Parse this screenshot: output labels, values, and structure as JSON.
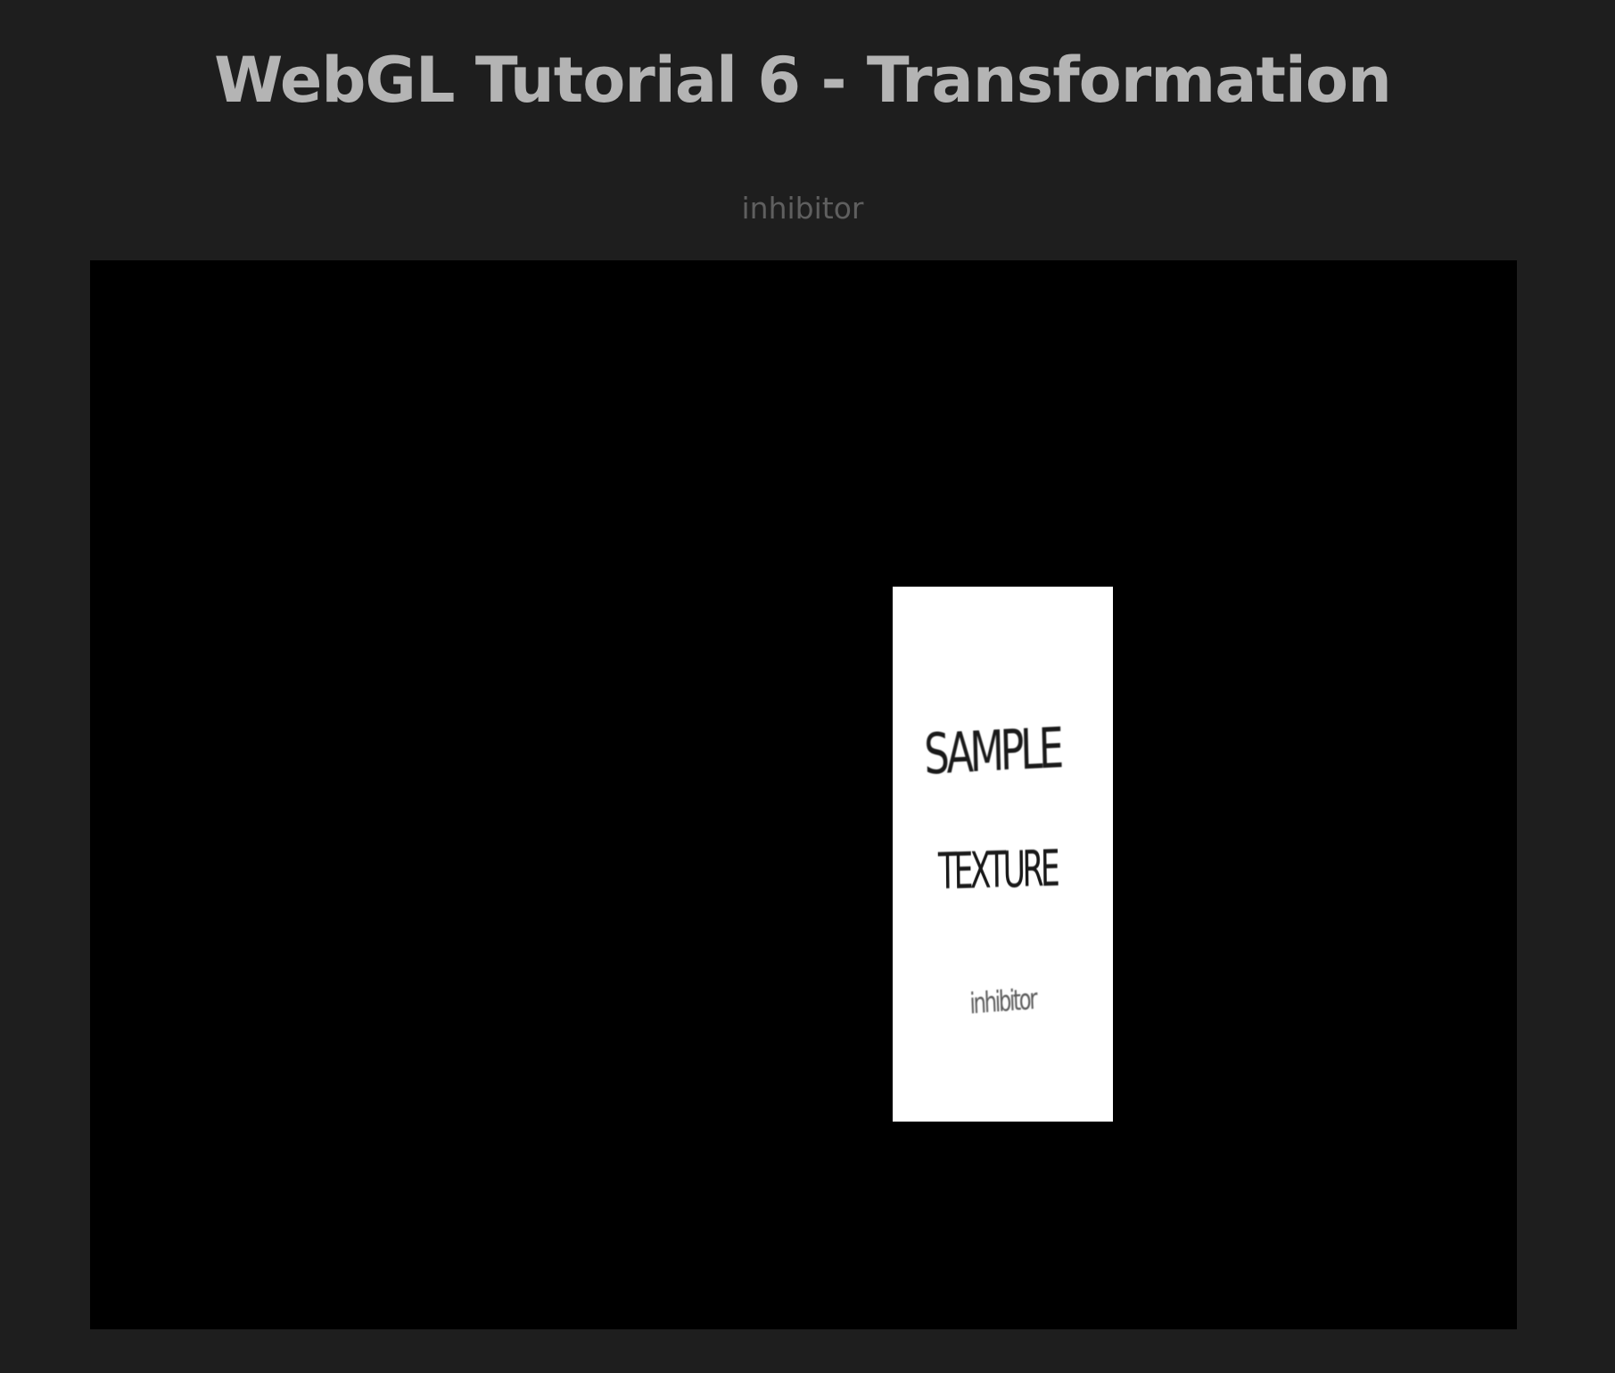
{
  "header": {
    "title": "WebGL Tutorial 6 - Transformation",
    "author": "inhibitor"
  },
  "canvas": {
    "background_color": "#000000",
    "texture": {
      "line1": "SAMPLE",
      "line2": "TEXTURE",
      "line3": "inhibitor"
    }
  },
  "colors": {
    "page_background": "#1e1e1e",
    "title": "#b4b4b4",
    "author": "#5f5f5f",
    "quad": "#ffffff"
  }
}
